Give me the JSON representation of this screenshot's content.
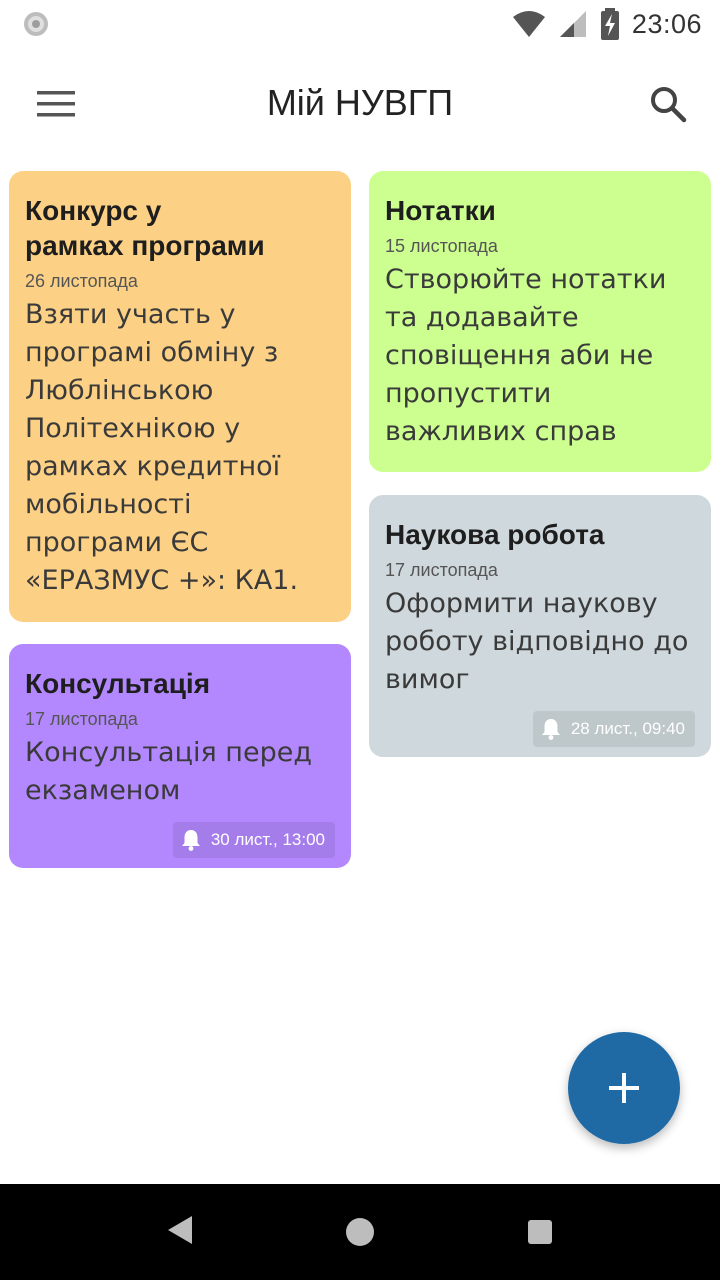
{
  "status_bar": {
    "time": "23:06"
  },
  "app_bar": {
    "title": "Мій НУВГП",
    "menu_icon": "hamburger-menu-icon",
    "search_icon": "search-icon"
  },
  "notes": [
    {
      "title": "Конкурс у\nрамках програми",
      "date": "26 листопада",
      "body": "Взяти участь у програмі обміну з Люблінською Політехнікою у рамках кредитної мобільності програми ЄС «ЕРАЗМУС +»: КА1.",
      "color": "#fdd185",
      "reminder": ""
    },
    {
      "title": "Нотатки",
      "date": "15 листопада",
      "body": "Створюйте нотатки та додавайте сповіщення аби не пропустити важливих справ",
      "color": "#ccff90",
      "reminder": ""
    },
    {
      "title": "Консультація",
      "date": "17 листопада",
      "body": "Консультація перед екзаменом",
      "color": "#b388ff",
      "reminder": "30 лист., 13:00"
    },
    {
      "title": "Наукова робота",
      "date": "17 листопада",
      "body": "Оформити наукову роботу відповідно до вимог",
      "color": "#cfd8dc",
      "reminder": "28 лист., 09:40"
    }
  ],
  "fab": {
    "icon": "plus-icon",
    "color": "#1f6aa5"
  }
}
